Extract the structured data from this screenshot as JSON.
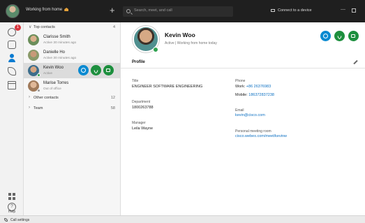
{
  "titlebar": {
    "status_text": "Working from home",
    "search_placeholder": "Search, meet, and call",
    "connect_label": "Connect to a device",
    "minimize_glyph": "—"
  },
  "rail": {
    "unread_badge": "1",
    "help_label": "Help"
  },
  "contacts": {
    "groups": [
      {
        "label": "Top contacts",
        "count": "4",
        "expanded": true
      },
      {
        "label": "Other contacts",
        "count": "12",
        "expanded": false
      },
      {
        "label": "Team",
        "count": "58",
        "expanded": false
      }
    ],
    "items": [
      {
        "name": "Clarisse Smith",
        "status": "Active 30 minutes ago"
      },
      {
        "name": "Danielle Ho",
        "status": "Active 30 minutes ago"
      },
      {
        "name": "Kevin Woo",
        "status": "Active",
        "selected": true
      },
      {
        "name": "Marise Torres",
        "status": "Out of office"
      }
    ]
  },
  "profile": {
    "name": "Kevin Woo",
    "status_line": "Active  |  Working from home today",
    "tab_label": "Profile",
    "title_label": "Title",
    "title_value": "ENGINEER SOFTWARE ENGINEERING",
    "department_label": "Department",
    "department_value": "1800263788",
    "manager_label": "Manager",
    "manager_value": "Leila Wayne",
    "phone_label": "Phone",
    "work_key": "Work:",
    "work_value": "+86 26376983",
    "mobile_key": "Mobile:",
    "mobile_value": "186372837238",
    "email_label": "Email",
    "email_value": "kevin@cisco.com",
    "pmr_label": "Personal meeting room",
    "pmr_value": "cisco.webex.com/meet/kevinw"
  },
  "statusbar": {
    "call_settings_label": "Call settings"
  },
  "colors": {
    "accent_blue": "#0a8ad1",
    "call_green": "#1d8f3e",
    "presence_active": "#2fa24f",
    "badge_red": "#d9363e"
  }
}
